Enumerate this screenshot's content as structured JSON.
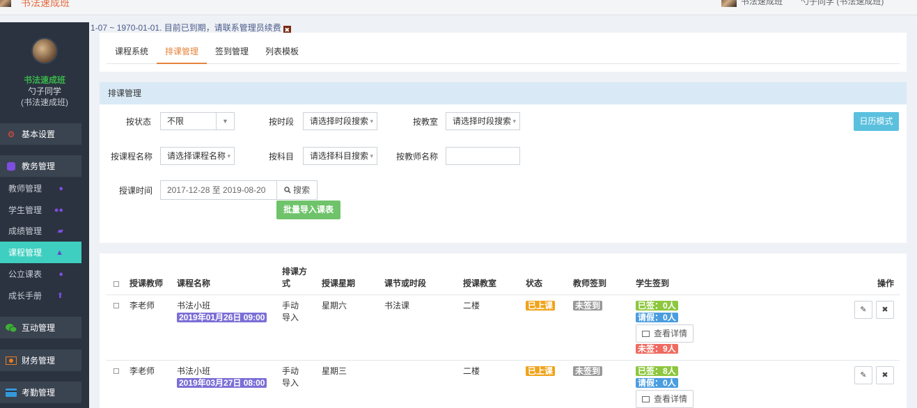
{
  "topbar": {
    "title": "书法速成班",
    "user_name": "书法速成班",
    "user_info": "勺子同学 (书法速成班)"
  },
  "sidebar": {
    "profile": {
      "org": "书法速成班",
      "name": "勺子同学",
      "org_paren": "(书法速成班)"
    },
    "groups": [
      {
        "label": "基本设置",
        "icon": "gear-icon",
        "color": "#e74c3c"
      },
      {
        "label": "教务管理",
        "icon": "database-icon",
        "color": "#7e4ee0"
      },
      {
        "label": "互动管理",
        "icon": "wechat-icon",
        "color": "#3cb034"
      },
      {
        "label": "财务管理",
        "icon": "money-icon",
        "color": "#e67e22"
      },
      {
        "label": "考勤管理",
        "icon": "card-icon",
        "color": "#3498db"
      }
    ],
    "items": [
      {
        "label": "教师管理",
        "icon": "user-icon"
      },
      {
        "label": "学生管理",
        "icon": "users-icon"
      },
      {
        "label": "成绩管理",
        "icon": "book-icon"
      },
      {
        "label": "课程管理",
        "icon": "graduation-cap-icon",
        "active": true
      },
      {
        "label": "公立课表",
        "icon": "apple-icon"
      },
      {
        "label": "成长手册",
        "icon": "arrow-up-icon"
      }
    ]
  },
  "notice": {
    "text": "1-07 ~ 1970-01-01. 目前已到期，请联系管理员续费"
  },
  "tabs": [
    "课程系统",
    "排课管理",
    "签到管理",
    "列表模板"
  ],
  "filter": {
    "header": "排课管理",
    "status_label": "按状态",
    "status_value": "不限",
    "period_label": "按时段",
    "period_placeholder": "请选择时段搜索",
    "room_label": "按教室",
    "room_placeholder": "请选择时段搜索",
    "course_label": "按课程名称",
    "course_placeholder": "请选择课程名称",
    "subject_label": "按科目",
    "subject_placeholder": "请选择科目搜索",
    "teacher_label": "按教师名称",
    "teacher_value": "",
    "time_label": "授课时间",
    "time_value": "2017-12-28 至 2019-08-20",
    "search_label": "搜索",
    "calendar_label": "日历模式",
    "import_label": "批量导入课表"
  },
  "table": {
    "headers": {
      "teacher": "授课教师",
      "course": "课程名称",
      "mode": "排课方式",
      "weekday": "授课星期",
      "period": "课节或时段",
      "room": "授课教室",
      "status": "状态",
      "teacher_sign": "教师签到",
      "student_sign": "学生签到",
      "ops": "操作"
    },
    "detail_label": "查看详情",
    "rows": [
      {
        "teacher": "李老师",
        "course": "书法小班",
        "datetime": "2019年01月26日 09:00",
        "mode": "手动导入",
        "weekday": "星期六",
        "period": "书法课",
        "room": "二楼",
        "status": "已上课",
        "teacher_sign": "未签到",
        "signed": "已签：0人",
        "leave": "请假：0人",
        "unsigned": "未签：9人"
      },
      {
        "teacher": "李老师",
        "course": "书法小班",
        "datetime": "2019年03月27日 08:00",
        "mode": "手动导入",
        "weekday": "星期三",
        "period": "",
        "room": "二楼",
        "status": "已上课",
        "teacher_sign": "未签到",
        "signed": "已签：8人",
        "leave": "请假：0人"
      }
    ]
  }
}
